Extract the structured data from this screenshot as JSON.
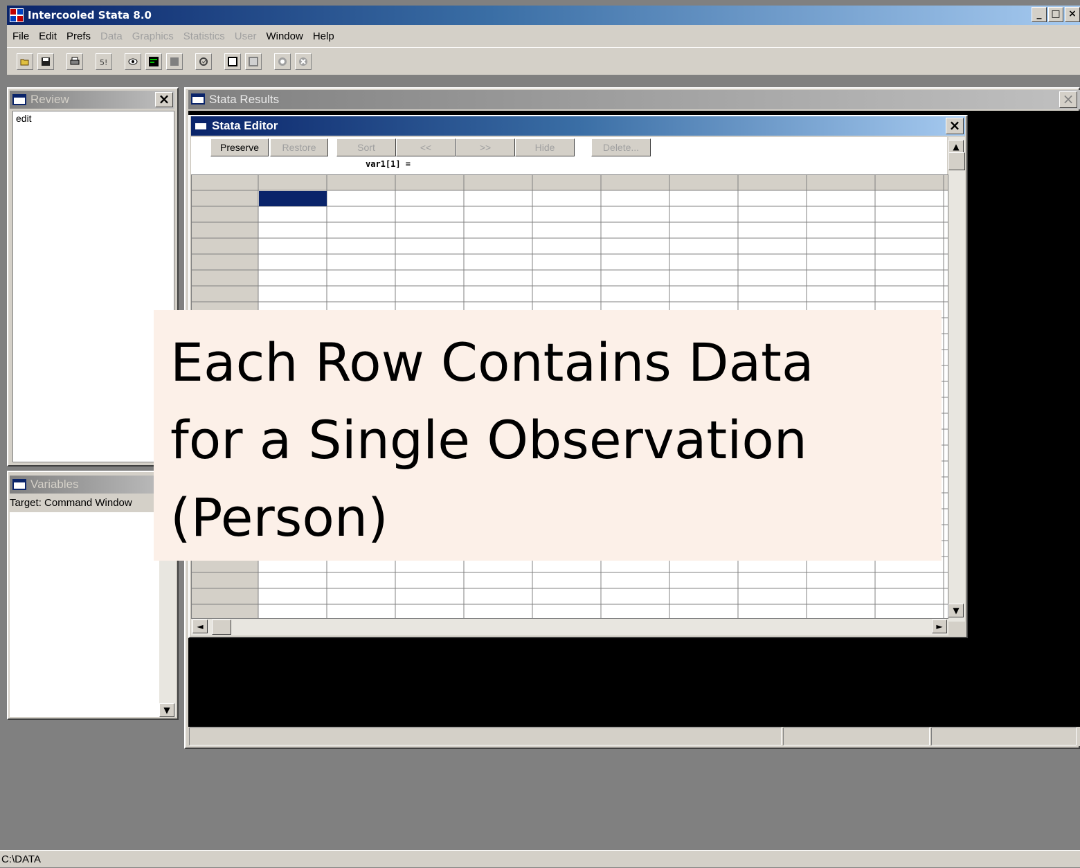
{
  "window": {
    "title": "Intercooled Stata 8.0",
    "controls": [
      "_",
      "□",
      "×"
    ]
  },
  "menu": {
    "items": [
      {
        "label": "File",
        "enabled": true
      },
      {
        "label": "Edit",
        "enabled": true
      },
      {
        "label": "Prefs",
        "enabled": true
      },
      {
        "label": "Data",
        "enabled": false
      },
      {
        "label": "Graphics",
        "enabled": false
      },
      {
        "label": "Statistics",
        "enabled": false
      },
      {
        "label": "User",
        "enabled": false
      },
      {
        "label": "Window",
        "enabled": true
      },
      {
        "label": "Help",
        "enabled": true
      }
    ]
  },
  "review": {
    "title": "Review",
    "close": "×",
    "items": [
      "edit"
    ]
  },
  "variables": {
    "title": "Variables",
    "target": "Target: Command Window"
  },
  "results": {
    "title": "Stata Results",
    "close": "×"
  },
  "editor": {
    "title": "Stata Editor",
    "close": "×",
    "buttons": {
      "preserve": "Preserve",
      "restore": "Restore",
      "sort": "Sort",
      "prev": "<<",
      "next": ">>",
      "hide": "Hide",
      "delete": "Delete..."
    },
    "cell_label": "var1[1] ="
  },
  "overlay": {
    "line1": "Each Row Contains Data",
    "line2": "for a Single Observation",
    "line3": "(Person)"
  },
  "statusbar": {
    "path": "C:\\DATA"
  },
  "colors": {
    "title_active": "#0a246a",
    "face": "#d4d0c8",
    "selected_cell": "#0a246a",
    "overlay_bg": "#fcf0e8"
  }
}
